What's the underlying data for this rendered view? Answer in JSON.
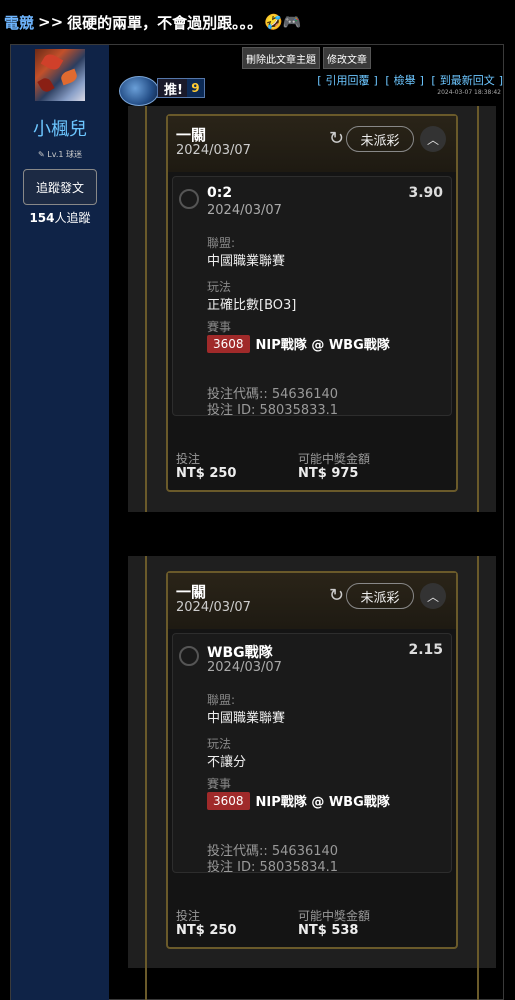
{
  "breadcrumb": {
    "category": "電競",
    "sep": ">>",
    "title": "很硬的兩單，不會過別跟。。。",
    "emoji": "🤣🎮"
  },
  "user": {
    "name": "小楓兒",
    "level": "Lv.1 球迷",
    "follow_label": "追蹤發文",
    "followers_count": "154",
    "followers_suffix": "人追蹤"
  },
  "actions": {
    "delete_topic": "刪除此文章主題",
    "edit_post": "修改文章"
  },
  "push": {
    "label": "推!",
    "count": "9"
  },
  "links": {
    "quote": "引用回覆",
    "report": "檢舉",
    "latest": "到最新回文"
  },
  "post_time": "2024-03-07 18:38:42",
  "cards": [
    {
      "title": "一關",
      "date": "2024/03/07",
      "status": "未派彩",
      "pick": "0:2",
      "odds": "3.90",
      "pick_date": "2024/03/07",
      "league_label": "聯盟:",
      "league": "中國職業聯賽",
      "play_label": "玩法",
      "play": "正確比數[BO3]",
      "event_label": "賽事",
      "event_id": "3608",
      "event": "NIP戰隊 @ WBG戰隊",
      "code": "投注代碼:: 54636140",
      "bet_id": "投注 ID: 58035833.1",
      "stake_label": "投注",
      "stake": "NT$ 250",
      "win_label": "可能中獎金額",
      "win": "NT$ 975"
    },
    {
      "title": "一關",
      "date": "2024/03/07",
      "status": "未派彩",
      "pick": "WBG戰隊",
      "odds": "2.15",
      "pick_date": "2024/03/07",
      "league_label": "聯盟:",
      "league": "中國職業聯賽",
      "play_label": "玩法",
      "play": "不讓分",
      "event_label": "賽事",
      "event_id": "3608",
      "event": "NIP戰隊 @ WBG戰隊",
      "code": "投注代碼:: 54636140",
      "bet_id": "投注 ID: 58035834.1",
      "stake_label": "投注",
      "stake": "NT$ 250",
      "win_label": "可能中獎金額",
      "win": "NT$ 538"
    }
  ]
}
